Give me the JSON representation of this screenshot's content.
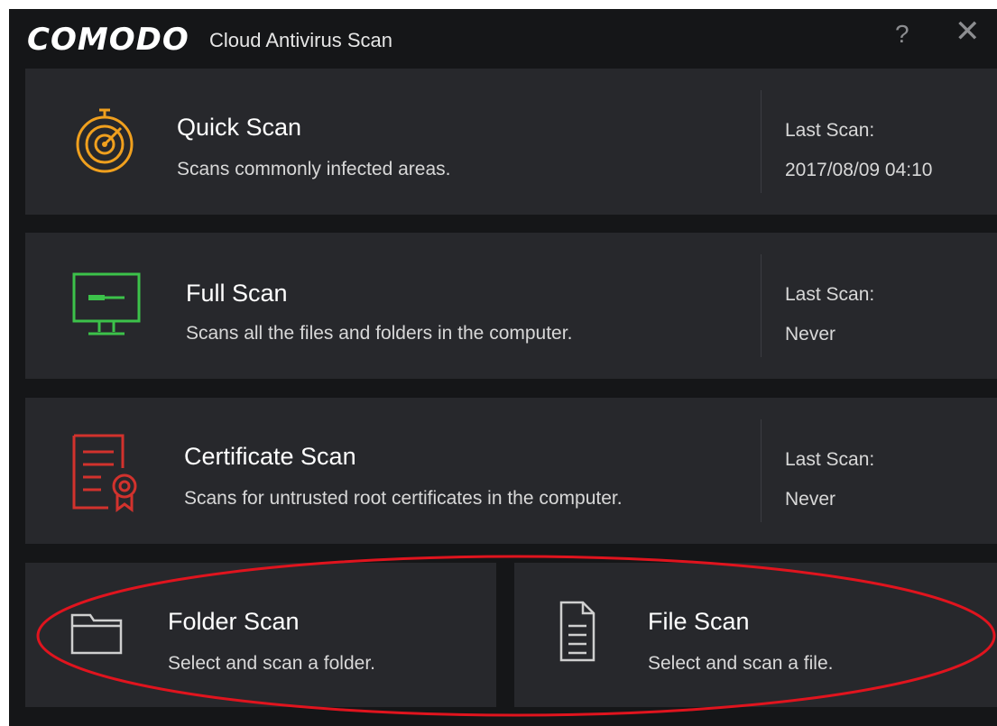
{
  "window": {
    "brand": "COMODO",
    "title": "Cloud Antivirus Scan",
    "help": "?",
    "close": "✕"
  },
  "scans": {
    "quick": {
      "title": "Quick Scan",
      "desc": "Scans commonly infected areas.",
      "last_label": "Last Scan:",
      "last_value": "2017/08/09 04:10"
    },
    "full": {
      "title": "Full Scan",
      "desc": "Scans all the files and folders in the computer.",
      "last_label": "Last Scan:",
      "last_value": "Never"
    },
    "certificate": {
      "title": "Certificate Scan",
      "desc": "Scans for untrusted root certificates in the computer.",
      "last_label": "Last Scan:",
      "last_value": "Never"
    },
    "folder": {
      "title": "Folder Scan",
      "desc": "Select and scan a folder."
    },
    "file": {
      "title": "File Scan",
      "desc": "Select and scan a file."
    }
  },
  "colors": {
    "quick_icon": "#f0a01e",
    "full_icon": "#3cc24a",
    "certificate_icon": "#d2322d",
    "annotation": "#e0141e"
  }
}
